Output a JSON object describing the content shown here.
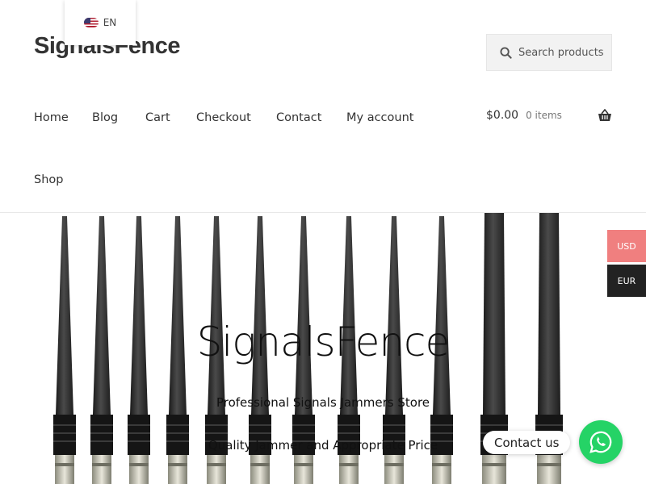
{
  "language": {
    "code": "EN",
    "flag_icon": "us-flag-icon"
  },
  "site": {
    "title": "SignalsFence"
  },
  "search": {
    "placeholder": "Search products",
    "icon": "search-icon"
  },
  "nav": {
    "items": [
      {
        "label": "Home"
      },
      {
        "label": "Blog"
      },
      {
        "label": "Cart"
      },
      {
        "label": "Checkout"
      },
      {
        "label": "Contact"
      },
      {
        "label": "My account"
      },
      {
        "label": "Shop"
      }
    ]
  },
  "cart": {
    "amount": "$0.00",
    "count": "0 items",
    "icon": "basket-icon"
  },
  "hero": {
    "title": "SignalsFence",
    "subtitle": "Professional Signals Jammers Store",
    "tagline": "Quality Jammer and Appropriate Price"
  },
  "currency": {
    "options": [
      "USD",
      "EUR"
    ],
    "active_color": "#f07f7f"
  },
  "chat": {
    "label": "Contact us",
    "icon": "whatsapp-icon",
    "color": "#25d366"
  }
}
